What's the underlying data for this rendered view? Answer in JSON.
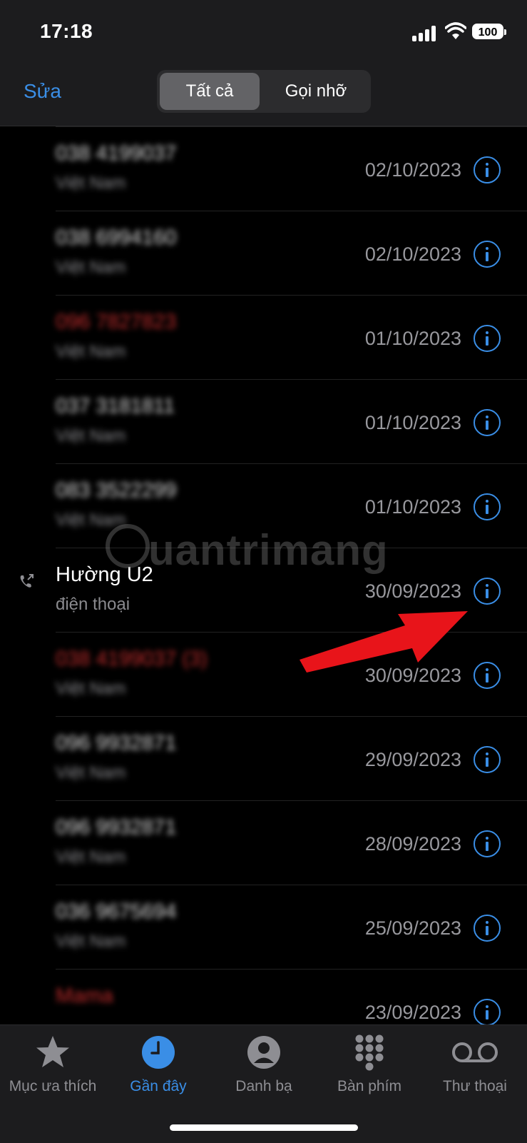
{
  "status": {
    "time": "17:18",
    "battery": "100"
  },
  "nav": {
    "edit_label": "Sửa",
    "segments": [
      "Tất cả",
      "Gọi nhỡ"
    ]
  },
  "calls": [
    {
      "name": "038 4199037",
      "sub": "Việt Nam",
      "date": "02/10/2023",
      "missed": false,
      "blurred": true
    },
    {
      "name": "038 6994160",
      "sub": "Việt Nam",
      "date": "02/10/2023",
      "missed": false,
      "blurred": true
    },
    {
      "name": "096 7827823",
      "sub": "Việt Nam",
      "date": "01/10/2023",
      "missed": true,
      "blurred": true
    },
    {
      "name": "037 3181811",
      "sub": "Việt Nam",
      "date": "01/10/2023",
      "missed": false,
      "blurred": true
    },
    {
      "name": "083 3522299",
      "sub": "Việt Nam",
      "date": "01/10/2023",
      "missed": false,
      "blurred": true
    },
    {
      "name": "Hường U2",
      "sub": "điện thoại",
      "date": "30/09/2023",
      "missed": false,
      "blurred": false,
      "outgoing": true
    },
    {
      "name": "038 4199037 (3)",
      "sub": "Việt Nam",
      "date": "30/09/2023",
      "missed": true,
      "blurred": true
    },
    {
      "name": "096 9932871",
      "sub": "Việt Nam",
      "date": "29/09/2023",
      "missed": false,
      "blurred": true
    },
    {
      "name": "096 9932871",
      "sub": "Việt Nam",
      "date": "28/09/2023",
      "missed": false,
      "blurred": true
    },
    {
      "name": "036 9675694",
      "sub": "Việt Nam",
      "date": "25/09/2023",
      "missed": false,
      "blurred": true
    },
    {
      "name": "Mama",
      "sub": "",
      "date": "23/09/2023",
      "missed": true,
      "blurred": true
    }
  ],
  "watermark": "uantrimang",
  "tabs": [
    {
      "label": "Mục ưa thích",
      "icon": "star-icon",
      "active": false
    },
    {
      "label": "Gần đây",
      "icon": "clock-icon",
      "active": true
    },
    {
      "label": "Danh bạ",
      "icon": "person-icon",
      "active": false
    },
    {
      "label": "Bàn phím",
      "icon": "keypad-icon",
      "active": false
    },
    {
      "label": "Thư thoại",
      "icon": "voicemail-icon",
      "active": false
    }
  ],
  "colors": {
    "accent": "#3a8ee6",
    "missed": "#c22c2c",
    "background": "#000000",
    "bar": "#1c1c1e"
  }
}
